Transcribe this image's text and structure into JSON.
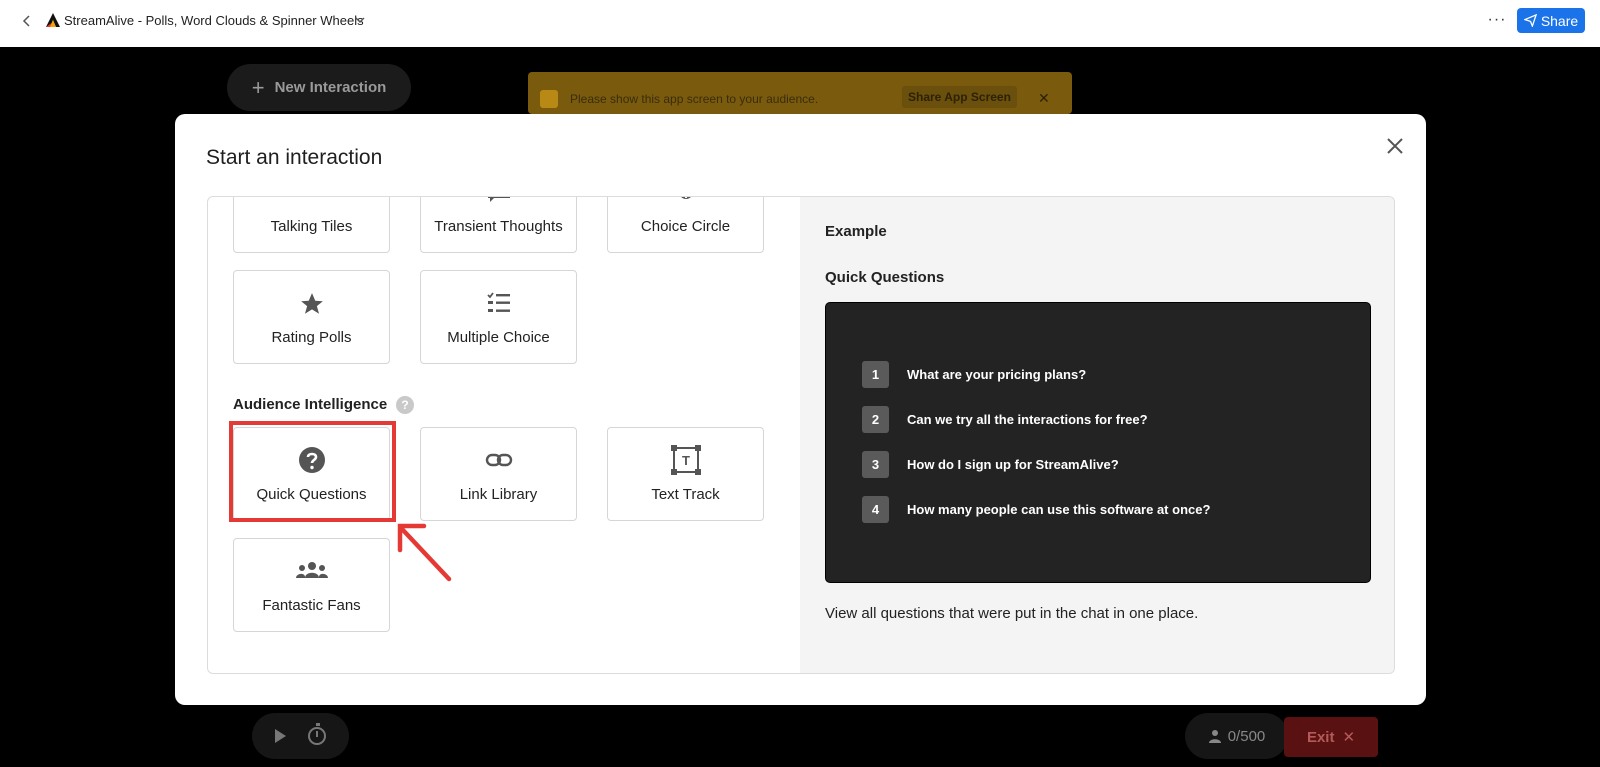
{
  "topbar": {
    "title": "StreamAlive - Polls, Word Clouds & Spinner Wheels",
    "more_label": "···",
    "share_label": "Share"
  },
  "background": {
    "new_interaction_label": "New Interaction",
    "notice_text": "Please show this app screen to your audience.",
    "notice_share_label": "Share App Screen",
    "user_count": "0/500",
    "exit_label": "Exit"
  },
  "modal": {
    "title": "Start an interaction",
    "tiles_row1": [
      {
        "label": "Talking Tiles",
        "icon": "tiles-icon"
      },
      {
        "label": "Transient Thoughts",
        "icon": "chat-icon"
      },
      {
        "label": "Choice Circle",
        "icon": "circle-icon"
      }
    ],
    "tiles_row2": [
      {
        "label": "Rating Polls",
        "icon": "star-icon"
      },
      {
        "label": "Multiple Choice",
        "icon": "checklist-icon"
      }
    ],
    "section_label": "Audience Intelligence",
    "help_icon": "?",
    "tiles_ai": [
      {
        "label": "Quick Questions",
        "icon": "question-circle-icon"
      },
      {
        "label": "Link Library",
        "icon": "link-icon"
      },
      {
        "label": "Text Track",
        "icon": "text-frame-icon"
      },
      {
        "label": "Fantastic Fans",
        "icon": "group-icon"
      }
    ],
    "example": {
      "heading": "Example",
      "subtitle": "Quick Questions",
      "questions": [
        {
          "num": "1",
          "text": "What are your pricing plans?"
        },
        {
          "num": "2",
          "text": "Can we try all the interactions for free?"
        },
        {
          "num": "3",
          "text": "How do I sign up for StreamAlive?"
        },
        {
          "num": "4",
          "text": "How many people can use this software at once?"
        }
      ],
      "description": "View all questions that were put in the chat in one place."
    }
  },
  "colors": {
    "highlight": "#e53935",
    "share_button": "#1a73e8",
    "exit_button": "#5a1111"
  }
}
